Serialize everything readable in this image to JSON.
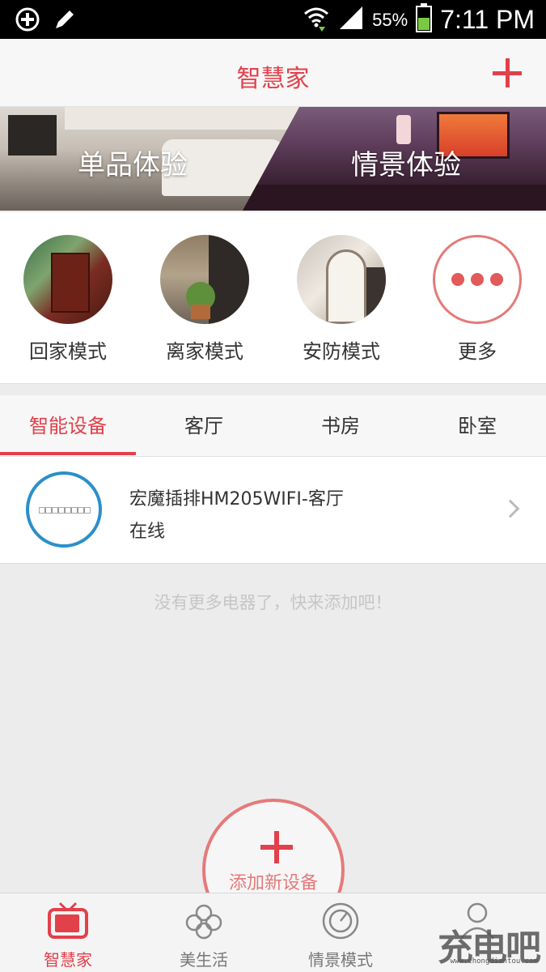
{
  "status_bar": {
    "battery_percent": "55%",
    "time": "7:11 PM",
    "icons": [
      "add-circle-icon",
      "pencil-icon",
      "wifi-icon",
      "signal-icon",
      "battery-icon"
    ]
  },
  "header": {
    "title": "智慧家",
    "add_icon": "plus-icon"
  },
  "banner": {
    "left_label": "单品体验",
    "right_label": "情景体验"
  },
  "modes": [
    {
      "label": "回家模式"
    },
    {
      "label": "离家模式"
    },
    {
      "label": "安防模式"
    },
    {
      "label": "更多"
    }
  ],
  "tabs": [
    {
      "label": "智能设备",
      "active": true
    },
    {
      "label": "客厅"
    },
    {
      "label": "书房"
    },
    {
      "label": "卧室"
    }
  ],
  "devices": [
    {
      "name": "宏魔插排HM205WIFI-客厅",
      "status": "在线"
    }
  ],
  "empty_message": "没有更多电器了，快来添加吧！",
  "fab": {
    "label": "添加新设备"
  },
  "bottom_nav": [
    {
      "label": "智慧家",
      "icon": "tv-icon",
      "active": true
    },
    {
      "label": "美生活",
      "icon": "clover-icon"
    },
    {
      "label": "情景模式",
      "icon": "dial-icon"
    },
    {
      "label": "",
      "icon": "profile-icon"
    }
  ],
  "watermark": {
    "text": "充电吧",
    "sub": "www.chongdiantou.com"
  },
  "colors": {
    "accent": "#e2404a",
    "device_ring": "#2b8fc9"
  }
}
